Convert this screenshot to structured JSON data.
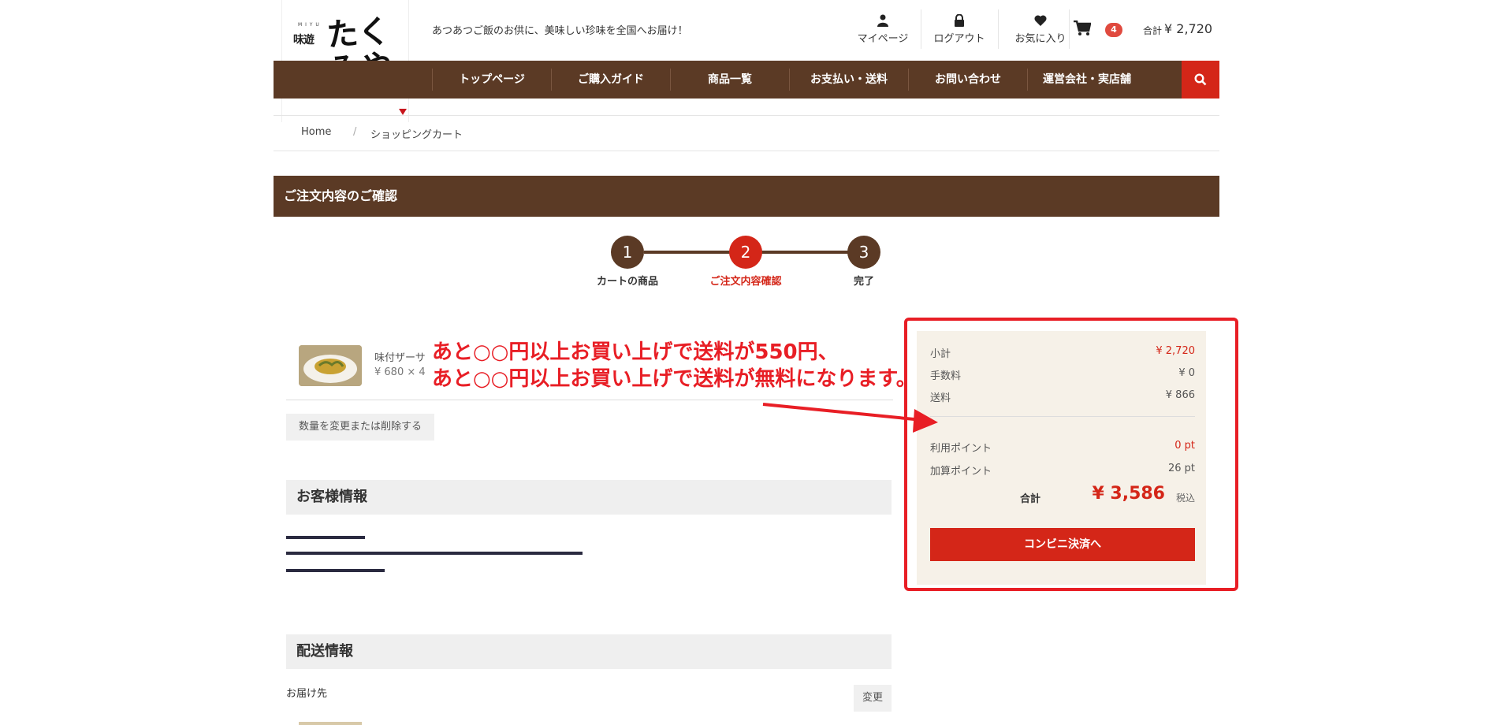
{
  "header": {
    "tagline": "あつあつご飯のお供に、美味しい珍味を全国へお届け！",
    "logo_small": "味遊",
    "logo_tiny": "M I Y U",
    "logo_big": "たくみや",
    "links": [
      {
        "label": "マイページ"
      },
      {
        "label": "ログアウト"
      },
      {
        "label": "お気に入り"
      }
    ],
    "cart_count": "4",
    "total_label": "合計",
    "total_value": "¥ 2,720"
  },
  "nav": {
    "items": [
      "トップページ",
      "ご購入ガイド",
      "商品一覧",
      "お支払い・送料",
      "お問い合わせ",
      "運営会社・実店舗"
    ]
  },
  "breadcrumb": {
    "home": "Home",
    "sep": "/",
    "current": "ショッピングカート"
  },
  "page": {
    "title": "ご注文内容のご確認"
  },
  "steps": [
    {
      "num": "1",
      "label": "カートの商品"
    },
    {
      "num": "2",
      "label": "ご注文内容確認",
      "active": true
    },
    {
      "num": "3",
      "label": "完了"
    }
  ],
  "product": {
    "name": "味付ザーサ",
    "price_qty": "¥ 680 × 4"
  },
  "change_qty_label": "数量を変更または削除する",
  "customer": {
    "heading": "お客様情報"
  },
  "delivery": {
    "heading": "配送情報",
    "dest_label": "お届け先",
    "change_label": "変更"
  },
  "summary": {
    "subtotal_label": "小計",
    "subtotal": "¥ 2,720",
    "fee_label": "手数料",
    "fee": "¥ 0",
    "shipping_label": "送料",
    "shipping": "¥ 866",
    "use_point_label": "利用ポイント",
    "use_point": "0 pt",
    "add_point_label": "加算ポイント",
    "add_point": "26 pt",
    "total_label": "合計",
    "total": "¥ 3,586",
    "tax_label": "税込",
    "pay_button": "コンビニ決済へ"
  },
  "annotation": {
    "line1": "あと○○円以上お買い上げで送料が550円、",
    "line2": "あと○○円以上お買い上げで送料が無料になります。"
  },
  "colors": {
    "brand_brown": "#5b3a25",
    "accent_red": "#d42618",
    "annotation_red": "#e81e25",
    "summary_bg": "#f6f1e8"
  }
}
